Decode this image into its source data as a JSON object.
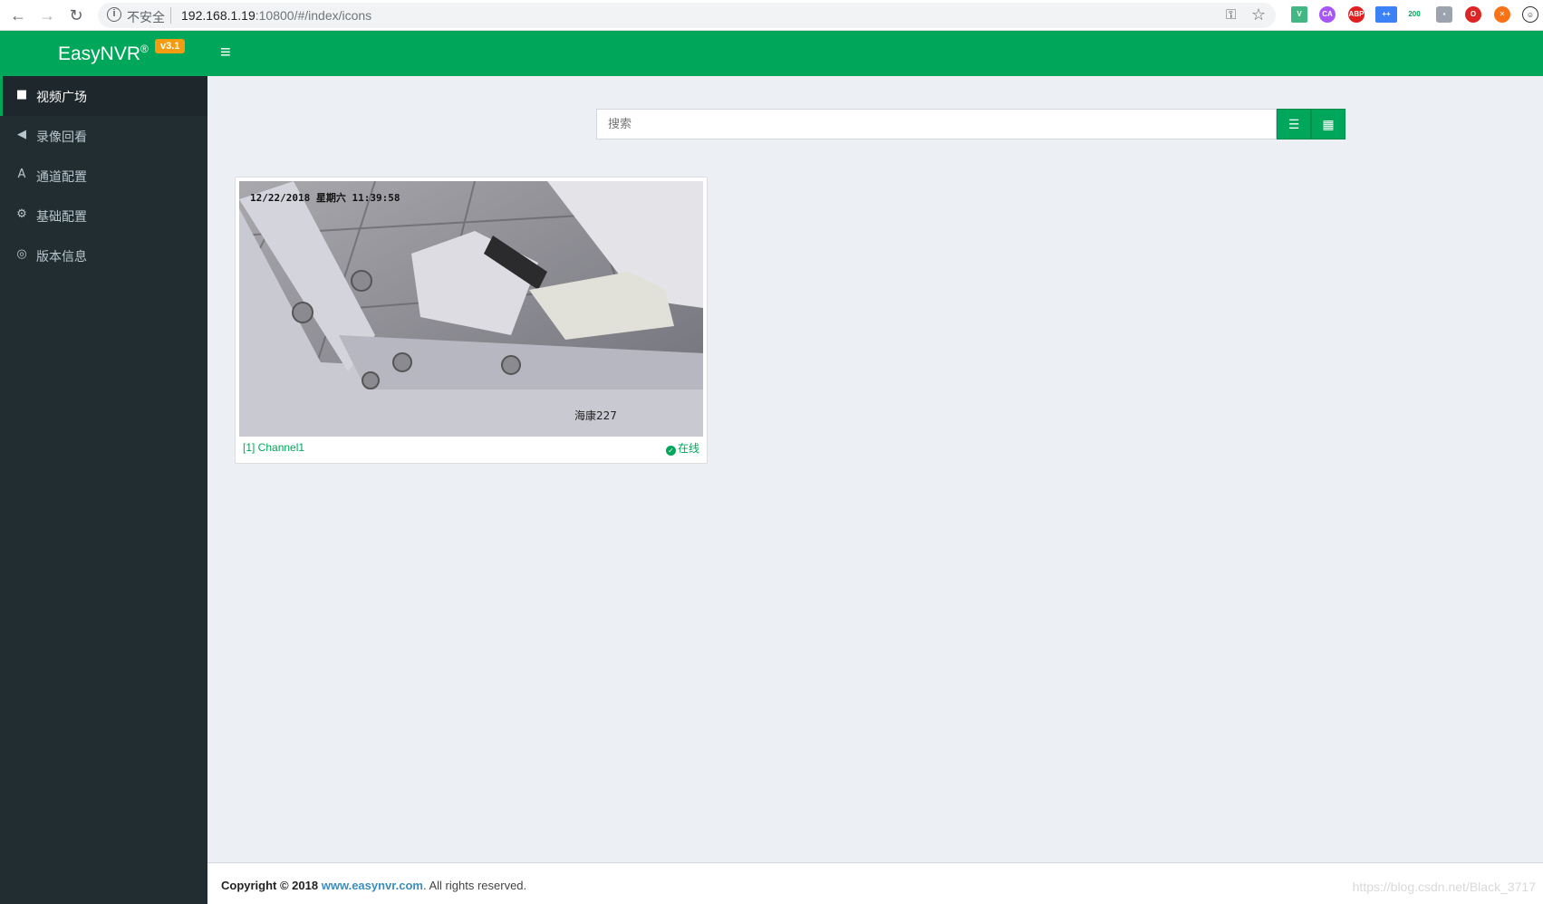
{
  "browser": {
    "insecure_label": "不安全",
    "url_host": "192.168.1.19",
    "url_rest": ":10800/#/index/icons",
    "ext_count": "200"
  },
  "app": {
    "logo": "EasyNVR",
    "logo_mark": "®",
    "version": "v3.1"
  },
  "sidebar": {
    "items": [
      {
        "label": "视频广场",
        "icon": "video-camera-icon"
      },
      {
        "label": "录像回看",
        "icon": "backward-icon"
      },
      {
        "label": "通道配置",
        "icon": "road-icon"
      },
      {
        "label": "基础配置",
        "icon": "cogs-icon"
      },
      {
        "label": "版本信息",
        "icon": "life-ring-icon"
      }
    ]
  },
  "search": {
    "placeholder": "搜索"
  },
  "channel": {
    "title": "[1] Channel1",
    "status": "在线",
    "osd_time": "12/22/2018 星期六 11:39:58",
    "osd_name": "海康227"
  },
  "footer": {
    "copyright": "Copyright © 2018",
    "link": "www.easynvr.com",
    "rest": ". All rights reserved.",
    "watermark": "https://blog.csdn.net/Black_3717"
  },
  "colors": {
    "primary": "#00a65a",
    "sidebar": "#222d32",
    "badge": "#f39c12",
    "content_bg": "#ecf0f5"
  }
}
